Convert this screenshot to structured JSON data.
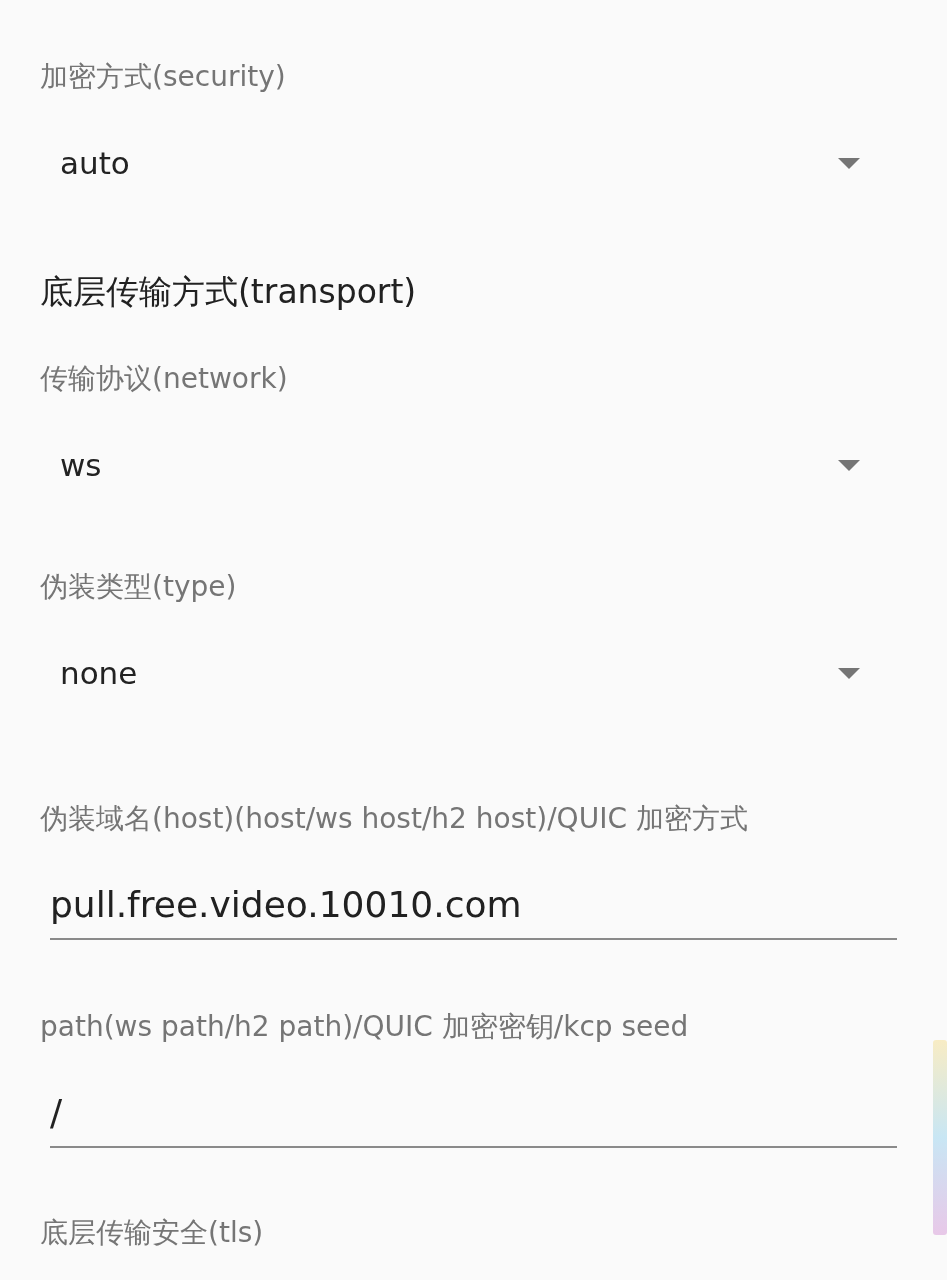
{
  "fields": [
    {
      "kind": "spinner",
      "label": "加密方式(security)",
      "value": "auto"
    },
    {
      "kind": "header",
      "label": "底层传输方式(transport)"
    },
    {
      "kind": "spinner",
      "label": "传输协议(network)",
      "value": "ws"
    },
    {
      "kind": "spinner",
      "label": "伪装类型(type)",
      "value": "none"
    },
    {
      "kind": "text_input",
      "label": "伪装域名(host)(host/ws host/h2 host)/QUIC 加密方式",
      "value": "pull.free.video.10010.com"
    },
    {
      "kind": "text_input",
      "label": "path(ws path/h2 path)/QUIC 加密密钥/kcp seed",
      "value": "/"
    },
    {
      "kind": "label",
      "label": "底层传输安全(tls)"
    }
  ]
}
